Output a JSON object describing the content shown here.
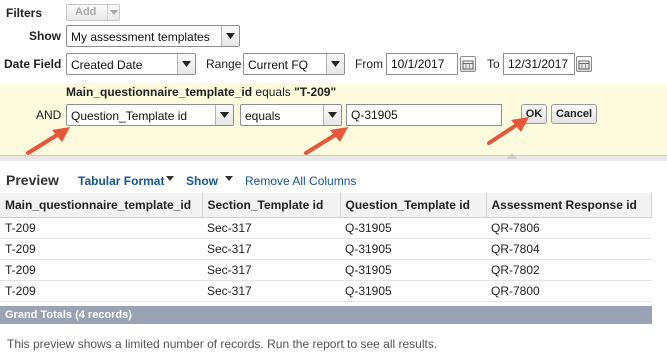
{
  "filters": {
    "label": "Filters",
    "add_button": "Add"
  },
  "show": {
    "label": "Show",
    "value": "My assessment templates"
  },
  "date_field": {
    "label": "Date Field",
    "value": "Created Date",
    "range_label": "Range",
    "range_value": "Current FQ",
    "from_label": "From",
    "from_value": "10/1/2017",
    "to_label": "To",
    "to_value": "12/31/2017"
  },
  "filter_row": {
    "condition_prefix": "Main_questionnaire_template_id",
    "condition_op": "equals",
    "condition_value": "\"T-209\"",
    "and_label": "AND",
    "field": "Question_Template id",
    "operator": "equals",
    "value": "Q-31905",
    "ok_button": "OK",
    "cancel_button": "Cancel",
    "arrow_color": "#e8563a"
  },
  "preview": {
    "title": "Preview",
    "format": "Tabular Format",
    "show": "Show",
    "remove_columns": "Remove All Columns",
    "link_color": "#15559a"
  },
  "table": {
    "headers": [
      "Main_questionnaire_template_id",
      "Section_Template id",
      "Question_Template id",
      "Assessment Response id"
    ],
    "rows": [
      [
        "T-209",
        "Sec-317",
        "Q-31905",
        "QR-7806"
      ],
      [
        "T-209",
        "Sec-317",
        "Q-31905",
        "QR-7804"
      ],
      [
        "T-209",
        "Sec-317",
        "Q-31905",
        "QR-7802"
      ],
      [
        "T-209",
        "Sec-317",
        "Q-31905",
        "QR-7800"
      ]
    ],
    "grand_totals": "Grand Totals (4 records)",
    "totals_bg": "#9aa3b3"
  },
  "footer_note": "This preview shows a limited number of records. Run the report to see all results."
}
